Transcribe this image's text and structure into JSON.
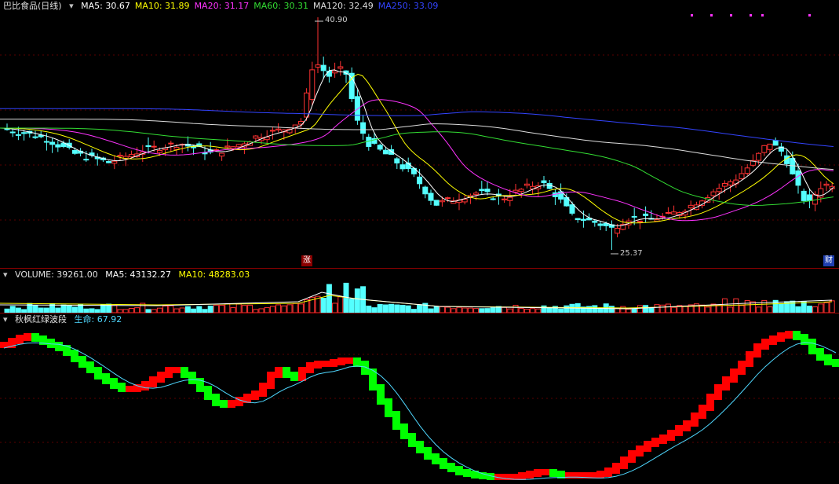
{
  "main_panel": {
    "title": "巴比食品(日线)",
    "ma": [
      {
        "label": "MA5: 30.67",
        "color": "#ffffff"
      },
      {
        "label": "MA10: 31.89",
        "color": "#ffff00"
      },
      {
        "label": "MA20: 31.17",
        "color": "#ff33ff"
      },
      {
        "label": "MA60: 30.31",
        "color": "#33dd33"
      },
      {
        "label": "MA120: 32.49",
        "color": "#dddddd"
      },
      {
        "label": "MA250: 33.09",
        "color": "#3344ff"
      }
    ],
    "high_label": "40.90",
    "low_label": "25.37",
    "zhang_badge": "涨",
    "cai_badge": "财"
  },
  "volume_panel": {
    "label": "VOLUME: 39261.00",
    "ma5": "MA5: 43132.27",
    "ma10": "MA10: 48283.03"
  },
  "indicator_panel": {
    "title": "秋枫红绿波段",
    "life": "生命: 67.92"
  },
  "colors": {
    "up": "#ff3232",
    "down": "#54ffff",
    "wave_up": "#ff0000",
    "wave_down": "#00ff00",
    "life_line": "#4fd8ff"
  },
  "chart_data": [
    {
      "type": "candlestick",
      "title": "巴比食品(日线)",
      "y_range": [
        25.37,
        40.9
      ],
      "annotated_high": 40.9,
      "annotated_low": 25.37,
      "moving_averages": {
        "MA5": 30.67,
        "MA10": 31.89,
        "MA20": 31.17,
        "MA60": 30.31,
        "MA120": 32.49,
        "MA250": 33.09
      }
    },
    {
      "type": "bar",
      "title": "VOLUME",
      "last_value": 39261.0,
      "moving_averages": {
        "MA5": 43132.27,
        "MA10": 48283.03
      }
    },
    {
      "type": "area",
      "title": "秋枫红绿波段",
      "life": 67.92
    }
  ]
}
